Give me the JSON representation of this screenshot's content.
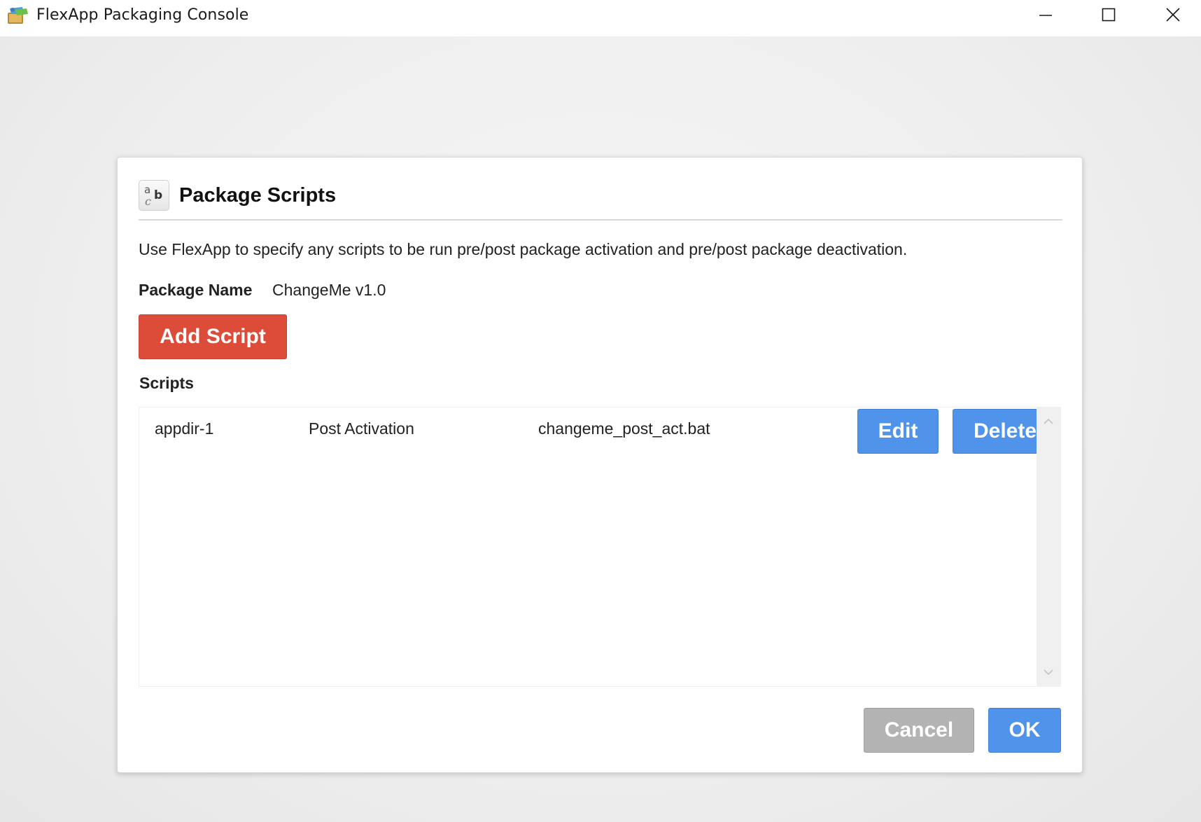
{
  "window": {
    "title": "FlexApp Packaging Console",
    "app_icon": "flexapp-icon",
    "controls": [
      "minimize-icon",
      "maximize-icon",
      "close-icon"
    ]
  },
  "dialog": {
    "icon": "text-abc-icon",
    "title": "Package Scripts",
    "description": "Use FlexApp to specify any scripts to be run pre/post package activation and pre/post package deactivation.",
    "package_name_label": "Package Name",
    "package_name_value": "ChangeMe v1.0",
    "add_script_label": "Add Script",
    "scripts_label": "Scripts",
    "scripts": [
      {
        "name": "appdir-1",
        "type": "Post Activation",
        "file": "changeme_post_act.bat",
        "edit_label": "Edit",
        "delete_label": "Delete"
      }
    ],
    "cancel_label": "Cancel",
    "ok_label": "OK"
  },
  "colors": {
    "add_button": "#dd4b39",
    "primary_button": "#4f93ea",
    "disabled_button": "#b3b3b3"
  }
}
